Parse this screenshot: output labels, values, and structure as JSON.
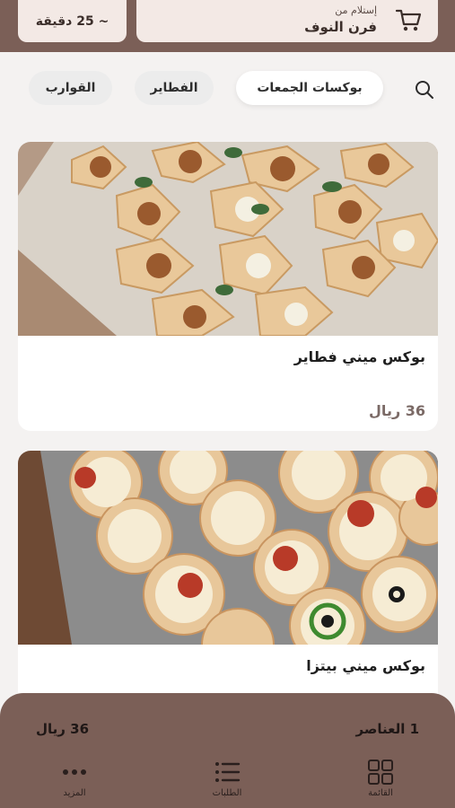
{
  "header": {
    "pickup_label": "إستلام من",
    "store_name": "فرن النوف",
    "eta": "~ 25 دقيقة"
  },
  "tabs": [
    {
      "label": "بوكسات الجمعات",
      "active": true
    },
    {
      "label": "الفطاير",
      "active": false
    },
    {
      "label": "القوارب",
      "active": false
    }
  ],
  "products": [
    {
      "title": "بوكس ميني فطاير",
      "price": "36 ريال"
    },
    {
      "title": "بوكس ميني بيتزا"
    }
  ],
  "cart_summary": {
    "items": "1 العناصر",
    "total": "36 ريال"
  },
  "bottom_nav": [
    {
      "label": "القائمة",
      "icon": "grid-icon"
    },
    {
      "label": "الطلبات",
      "icon": "list-icon"
    },
    {
      "label": "المزيد",
      "icon": "more-icon"
    }
  ],
  "colors": {
    "brand": "#7b5f57",
    "pill": "#f3e9e5",
    "background": "#f4f2f1"
  }
}
